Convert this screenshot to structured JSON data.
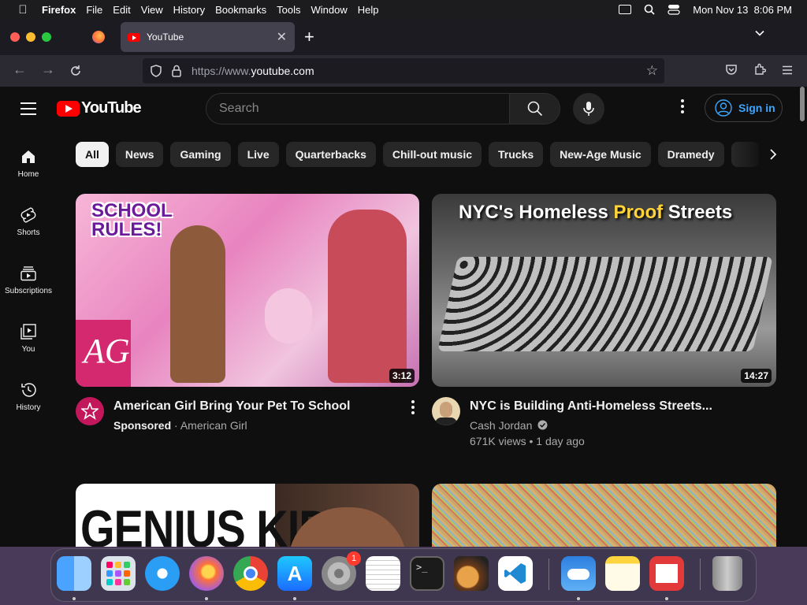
{
  "menubar": {
    "app": "Firefox",
    "items": [
      "File",
      "Edit",
      "View",
      "History",
      "Bookmarks",
      "Tools",
      "Window",
      "Help"
    ],
    "clock": "Mon Nov 13  8:06 PM",
    "icons": [
      "display-icon",
      "search-icon",
      "control-center-icon"
    ]
  },
  "browser": {
    "tab_title": "YouTube",
    "url_prefix": "https://www.",
    "url_domain": "youtube.com"
  },
  "youtube": {
    "logo_text": "YouTube",
    "search_placeholder": "Search",
    "signin_label": "Sign in",
    "rail": [
      {
        "label": "Home",
        "icon": "home-icon"
      },
      {
        "label": "Shorts",
        "icon": "shorts-icon"
      },
      {
        "label": "Subscriptions",
        "icon": "subscriptions-icon"
      },
      {
        "label": "You",
        "icon": "you-icon"
      },
      {
        "label": "History",
        "icon": "history-icon"
      }
    ],
    "chips": [
      "All",
      "News",
      "Gaming",
      "Live",
      "Quarterbacks",
      "Chill-out music",
      "Trucks",
      "New-Age Music",
      "Dramedy"
    ],
    "videos": [
      {
        "title": "American Girl Bring Your Pet To School",
        "thumb_text": "SCHOOL RULES!",
        "duration": "3:12",
        "line1_badge": "Sponsored",
        "line1_sep": "·",
        "channel": "American Girl",
        "avatar_color": "#c2185b"
      },
      {
        "title": "NYC is Building Anti-Homeless Streets...",
        "thumb_text_a": "NYC's Homeless ",
        "thumb_text_b": "Proof",
        "thumb_text_c": " Streets",
        "duration": "14:27",
        "channel": "Cash Jordan",
        "stats": "671K views • 1 day ago",
        "avatar_color": "#e8d7b0"
      },
      {
        "thumb_text": "GENIUS KID"
      },
      {}
    ]
  },
  "dock": {
    "apps": [
      "Finder",
      "Launchpad",
      "Safari",
      "Firefox",
      "Chrome",
      "App Store",
      "System Settings",
      "TextEdit",
      "Terminal",
      "GarageBand",
      "VS Code",
      "Weather",
      "Notes",
      "Photo Booth",
      "Trash"
    ],
    "settings_badge": "1"
  }
}
